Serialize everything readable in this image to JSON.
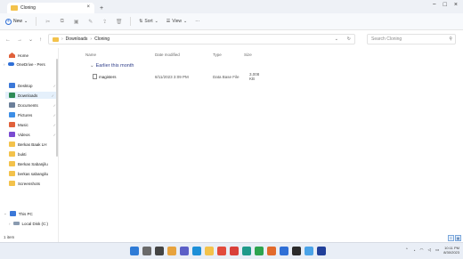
{
  "window": {
    "tab_title": "Cloning",
    "new_tab_glyph": "+",
    "tab_close_glyph": "×",
    "min_glyph": "−",
    "max_glyph": "□",
    "close_glyph": "×"
  },
  "commandbar": {
    "new_label": "New",
    "sort_label": "Sort",
    "view_label": "View",
    "more_label": "···"
  },
  "address": {
    "path": [
      "Downloads",
      "Cloning"
    ],
    "search_placeholder": "Search Cloning"
  },
  "sidebar": {
    "home": "Home",
    "onedrive": "OneDrive - Pers",
    "quick": [
      {
        "label": "Desktop",
        "icon": "desktop-icon",
        "color": "#3b78d8"
      },
      {
        "label": "Downloads",
        "icon": "downloads-icon",
        "color": "#2e8b57"
      },
      {
        "label": "Documents",
        "icon": "documents-icon",
        "color": "#6b7f99"
      },
      {
        "label": "Pictures",
        "icon": "pictures-icon",
        "color": "#3d8ee6"
      },
      {
        "label": "Music",
        "icon": "music-icon",
        "color": "#e0613b"
      },
      {
        "label": "Videos",
        "icon": "videos-icon",
        "color": "#7a4bd1"
      },
      {
        "label": "Berkas Baak LH",
        "icon": "folder-icon",
        "color": "#f3c24b"
      },
      {
        "label": "bukti",
        "icon": "folder-icon",
        "color": "#f3c24b"
      },
      {
        "label": "Berkas Sabanjilu",
        "icon": "folder-icon",
        "color": "#f3c24b"
      },
      {
        "label": "berkas sabangilu",
        "icon": "folder-icon",
        "color": "#f3c24b"
      },
      {
        "label": "Screenshots",
        "icon": "folder-icon",
        "color": "#f3c24b"
      }
    ],
    "thispc": "This PC",
    "localdisk": "Local Disk (C:)"
  },
  "content": {
    "columns": {
      "name": "Name",
      "date": "Date modified",
      "type": "Type",
      "size": "Size"
    },
    "group": "Earlier this month",
    "files": [
      {
        "name": "magisters",
        "date": "8/11/2023 3:09 PM",
        "type": "Data Base File",
        "size": "3,008 KB"
      }
    ]
  },
  "status": {
    "items": "1 item"
  },
  "taskbar": {
    "time": "10:11 PM",
    "date": "8/30/2023",
    "icons": [
      {
        "name": "start-icon",
        "color": "#2f7bd6"
      },
      {
        "name": "search-icon",
        "color": "#6a6a6a"
      },
      {
        "name": "task-view-icon",
        "color": "#444444"
      },
      {
        "name": "widgets-icon",
        "color": "#e7a33e"
      },
      {
        "name": "teams-icon",
        "color": "#5b5fc7"
      },
      {
        "name": "edge-icon",
        "color": "#1d8fd8"
      },
      {
        "name": "explorer-icon",
        "color": "#f3c24b"
      },
      {
        "name": "chrome-icon",
        "color": "#e24b3d"
      },
      {
        "name": "app-red-icon",
        "color": "#d9403a"
      },
      {
        "name": "app-teal-icon",
        "color": "#1f9a8a"
      },
      {
        "name": "app-green-icon",
        "color": "#2ea44f"
      },
      {
        "name": "app-orange-icon",
        "color": "#e26a2c"
      },
      {
        "name": "app-blue-icon",
        "color": "#2f6fd6"
      },
      {
        "name": "app-dark-icon",
        "color": "#2b2b2b"
      },
      {
        "name": "app-lightblue-icon",
        "color": "#4aa3e8"
      },
      {
        "name": "app-navy-icon",
        "color": "#21409a"
      }
    ]
  }
}
